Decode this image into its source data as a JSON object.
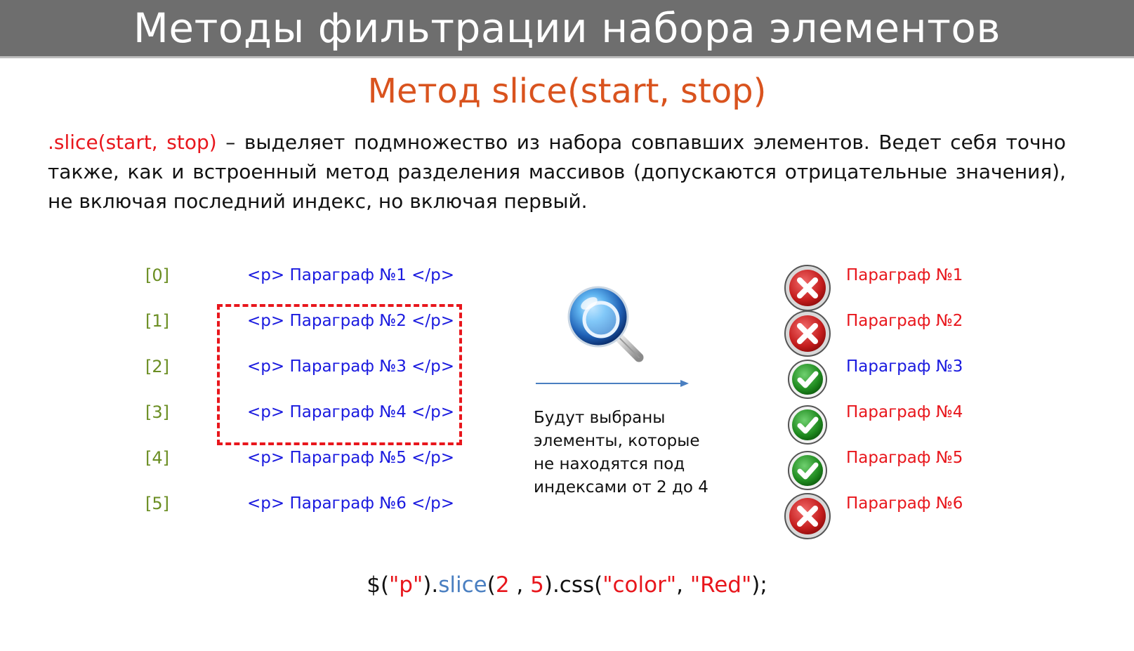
{
  "header": {
    "title": "Методы фильтрации набора элементов"
  },
  "subtitle": "Метод slice(start, stop)",
  "description": {
    "keyword": ".slice(start, stop)",
    "text": " – выделяет подмножество из набора совпавших элементов. Ведет себя точно также, как и встроенный метод разделения массивов (допускаются отрицательные значения), не включая последний индекс, но включая первый."
  },
  "source_list": {
    "indices": [
      "[0]",
      "[1]",
      "[2]",
      "[3]",
      "[4]",
      "[5]"
    ],
    "items": [
      "<p> Параграф №1 </p>",
      "<p> Параграф №2 </p>",
      "<p> Параграф №3 </p>",
      "<p> Параграф №4 </p>",
      "<p> Параграф №5 </p>",
      "<p> Параграф №6 </p>"
    ]
  },
  "note": "Будут выбраны элементы, которые не находятся под индексами от 2 до 4",
  "results": [
    {
      "label": "Параграф №1",
      "status": "cross-icon",
      "color": "#e8161c"
    },
    {
      "label": "Параграф №2",
      "status": "cross-icon",
      "color": "#e8161c"
    },
    {
      "label": "Параграф №3",
      "status": "check-icon",
      "color": "#1a1adf"
    },
    {
      "label": "Параграф №4",
      "status": "check-icon",
      "color": "#e8161c"
    },
    {
      "label": "Параграф №5",
      "status": "check-icon",
      "color": "#e8161c"
    },
    {
      "label": "Параграф №6",
      "status": "cross-icon",
      "color": "#e8161c"
    }
  ],
  "code_sample": {
    "p1": "$(",
    "sel": "\"p\"",
    "p2": ").",
    "fn": "slice",
    "p3": "(",
    "start": "2",
    "p4": " , ",
    "stop": "5",
    "p5": ").css(",
    "arg1": "\"color\"",
    "p6": ", ",
    "arg2": "\"Red\"",
    "p7": ");"
  },
  "colors": {
    "accent_orange": "#d9531e",
    "highlight_red": "#e8161c",
    "code_blue": "#1a1adf",
    "index_green": "#6b8e23",
    "header_gray": "#6e6e6e"
  }
}
